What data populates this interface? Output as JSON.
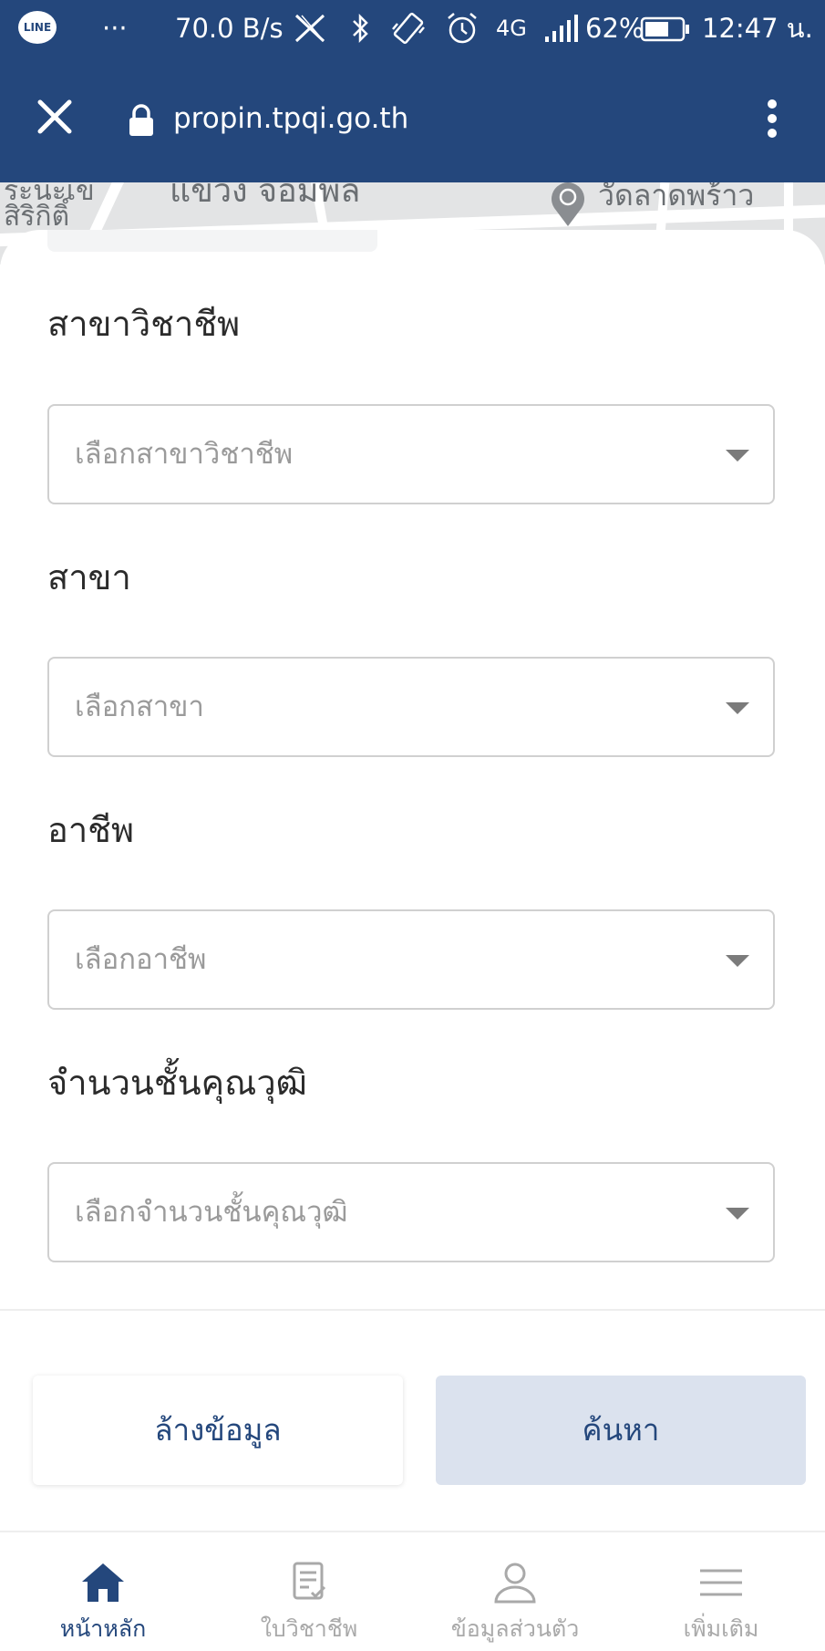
{
  "status_bar": {
    "app_icon": "LINE",
    "dots": "···",
    "speed": "70.0 B/s",
    "network": "4G",
    "battery": "62%",
    "time": "12:47 น."
  },
  "browser": {
    "url": "propin.tpqi.go.th"
  },
  "map": {
    "labels": [
      "ระนะเข",
      "สิริกิติ์",
      "แขวง จอมพล",
      "วัดลาดพร้าว"
    ]
  },
  "form": {
    "fields": [
      {
        "label": "สาขาวิชาชีพ",
        "placeholder": "เลือกสาขาวิชาชีพ"
      },
      {
        "label": "สาขา",
        "placeholder": "เลือกสาขา"
      },
      {
        "label": "อาชีพ",
        "placeholder": "เลือกอาชีพ"
      },
      {
        "label": "จำนวนชั้นคุณวุฒิ",
        "placeholder": "เลือกจำนวนชั้นคุณวุฒิ"
      }
    ],
    "clear_button": "ล้างข้อมูล",
    "search_button": "ค้นหา"
  },
  "bottom_nav": {
    "items": [
      {
        "label": "หน้าหลัก",
        "icon": "home-icon",
        "active": true
      },
      {
        "label": "ใบวิชาชีพ",
        "icon": "certificate-icon",
        "active": false
      },
      {
        "label": "ข้อมูลส่วนตัว",
        "icon": "user-icon",
        "active": false
      },
      {
        "label": "เพิ่มเติม",
        "icon": "menu-icon",
        "active": false
      }
    ]
  },
  "colors": {
    "brand": "#24477c",
    "search_button_bg": "#dbe2ee",
    "inactive_nav": "#a9a9a9"
  }
}
